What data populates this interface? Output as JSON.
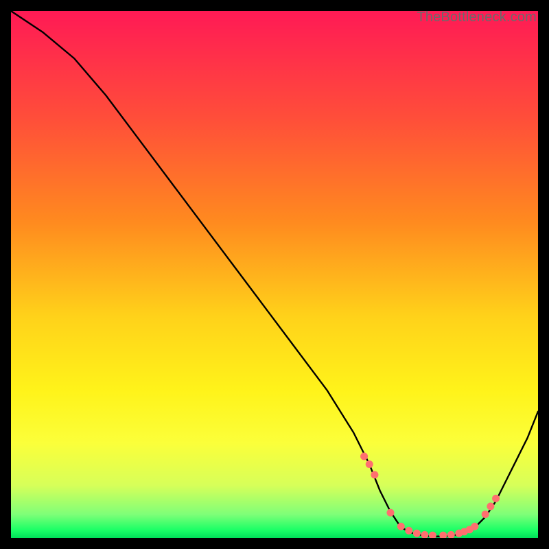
{
  "watermark": "TheBottleneck.com",
  "chart_data": {
    "type": "line",
    "title": "",
    "xlabel": "",
    "ylabel": "",
    "xlim": [
      0,
      100
    ],
    "ylim": [
      0,
      100
    ],
    "grid": false,
    "legend": false,
    "series": [
      {
        "name": "curve",
        "x": [
          0,
          6,
          12,
          18,
          24,
          30,
          36,
          42,
          48,
          54,
          60,
          65,
          68,
          70,
          72,
          74,
          76,
          78,
          80,
          82,
          84,
          86,
          88,
          90,
          92,
          94,
          96,
          98,
          100
        ],
        "y": [
          100,
          96,
          91,
          84,
          76,
          68,
          60,
          52,
          44,
          36,
          28,
          20,
          14,
          9,
          5,
          2,
          1,
          0.5,
          0.3,
          0.3,
          0.5,
          1,
          2,
          4,
          7,
          11,
          15,
          19,
          24
        ]
      }
    ],
    "markers": {
      "name": "dots",
      "color": "#ff6f6f",
      "x": [
        67,
        68,
        69,
        72,
        74,
        75.5,
        77,
        78.5,
        80,
        82,
        83.5,
        85,
        86,
        87,
        88,
        90,
        91,
        92
      ],
      "y": [
        15.5,
        14,
        12,
        4.8,
        2.2,
        1.4,
        0.9,
        0.6,
        0.5,
        0.5,
        0.6,
        0.9,
        1.2,
        1.6,
        2.2,
        4.5,
        6,
        7.5
      ]
    },
    "gradient_stops": [
      {
        "offset": 0.0,
        "color": "#ff1a55"
      },
      {
        "offset": 0.2,
        "color": "#ff4d3a"
      },
      {
        "offset": 0.4,
        "color": "#ff8a1f"
      },
      {
        "offset": 0.58,
        "color": "#ffd21a"
      },
      {
        "offset": 0.72,
        "color": "#fff31a"
      },
      {
        "offset": 0.82,
        "color": "#fbff3a"
      },
      {
        "offset": 0.9,
        "color": "#d7ff59"
      },
      {
        "offset": 0.955,
        "color": "#7fff78"
      },
      {
        "offset": 0.985,
        "color": "#1aff66"
      },
      {
        "offset": 1.0,
        "color": "#00e05a"
      }
    ]
  }
}
